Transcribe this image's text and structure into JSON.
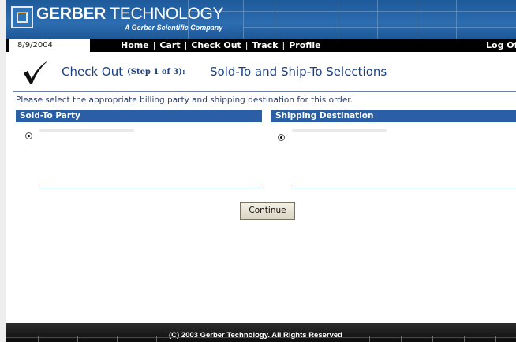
{
  "header": {
    "brand_bold": "GERBER",
    "brand_light": "TECHNOLOGY",
    "tagline": "A Gerber Scientific Company",
    "logo_icon": "gerber-logo-icon"
  },
  "nav": {
    "date": "8/9/2004",
    "links": [
      "Home",
      "Cart",
      "Check Out",
      "Track",
      "Profile"
    ],
    "separator": "|",
    "logoff": "Log Of"
  },
  "title": {
    "heading": "Check Out",
    "step": "(Step 1 of 3):",
    "section": "Sold-To and Ship-To Selections",
    "icon": "checkmark-icon"
  },
  "instructions": "Please select the appropriate billing party and shipping destination for this order.",
  "panels": {
    "sold_to_header": "Sold-To Party",
    "ship_to_header": "Shipping Destination"
  },
  "actions": {
    "continue": "Continue"
  },
  "footer": {
    "copyright": "(C) 2003 Gerber Technology. All Rights Reserved"
  },
  "colors": {
    "banner": "#2c6cb0",
    "nav_bar": "#000000",
    "panel_header": "#2a5fa6",
    "title_text": "#1a3f86"
  }
}
